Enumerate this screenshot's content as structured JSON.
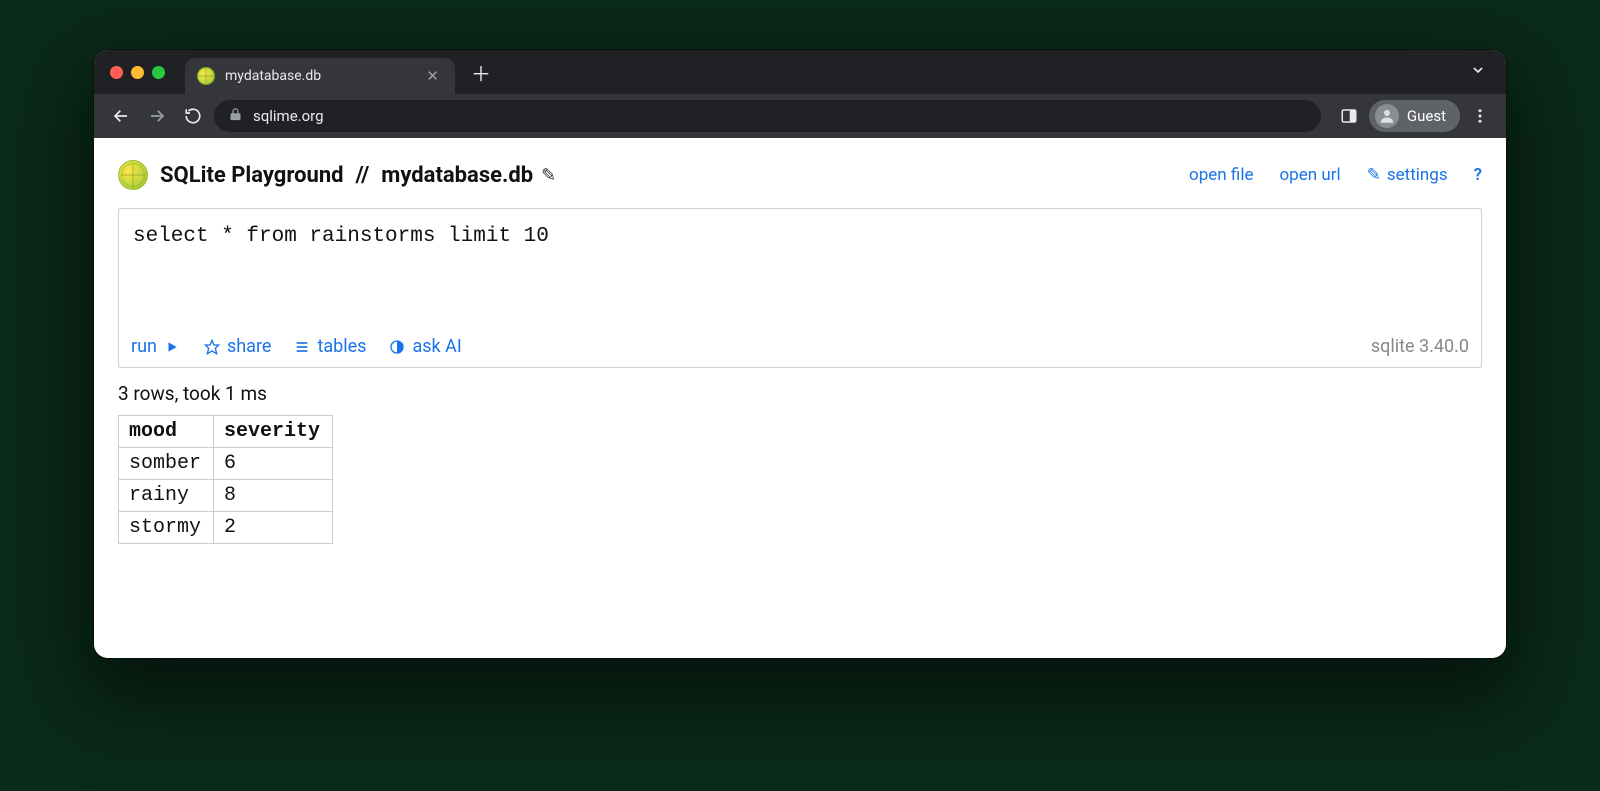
{
  "browser": {
    "tab_title": "mydatabase.db",
    "url_display": "sqlime.org",
    "profile_label": "Guest"
  },
  "header": {
    "brand": "SQLite Playground",
    "separator": "//",
    "db_name": "mydatabase.db",
    "links": {
      "open_file": "open file",
      "open_url": "open url",
      "settings": "settings",
      "help": "?"
    }
  },
  "editor": {
    "sql": "select * from rainstorms limit 10",
    "toolbar": {
      "run": "run",
      "share": "share",
      "tables": "tables",
      "ask_ai": "ask AI"
    },
    "engine": "sqlite 3.40.0"
  },
  "result": {
    "status": "3 rows, took 1 ms",
    "columns": [
      "mood",
      "severity"
    ],
    "rows": [
      [
        "somber",
        "6"
      ],
      [
        "rainy",
        "8"
      ],
      [
        "stormy",
        "2"
      ]
    ]
  }
}
